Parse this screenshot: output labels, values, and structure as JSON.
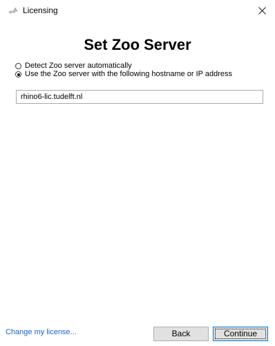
{
  "window": {
    "title": "Licensing",
    "title_icon": "rhino-icon",
    "close_icon": "close-icon"
  },
  "main": {
    "heading": "Set Zoo Server",
    "options": [
      {
        "label": "Detect Zoo server automatically",
        "selected": false
      },
      {
        "label": "Use the Zoo server with the following hostname or IP address",
        "selected": true
      }
    ],
    "hostname_value": "rhino6-lic.tudelft.nl"
  },
  "footer": {
    "change_license_link": "Change my license...",
    "back_label": "Back",
    "continue_label": "Continue"
  },
  "colors": {
    "link": "#1a63c7",
    "button_bg": "#e1e1e1",
    "default_button_border": "#0078d7"
  }
}
